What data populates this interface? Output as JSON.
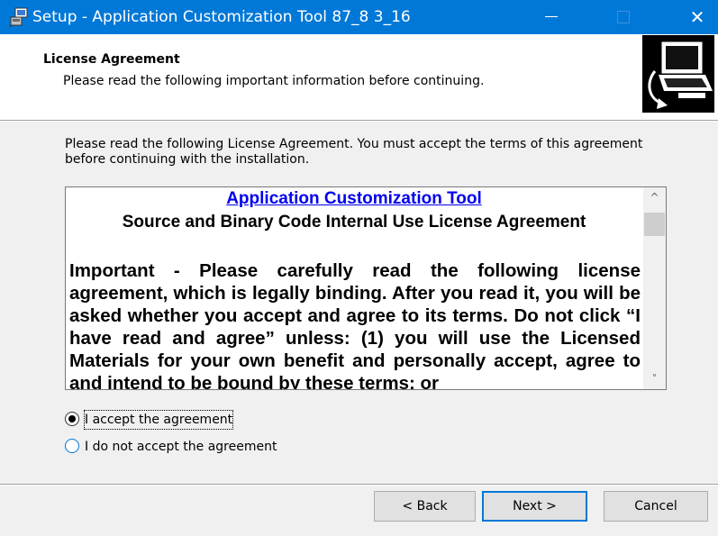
{
  "window": {
    "title": "Setup - Application Customization Tool 87_8 3_16",
    "close_glyph": "✕",
    "accent_color": "#0078d7"
  },
  "header": {
    "title": "License Agreement",
    "subtitle": "Please read the following important information before continuing.",
    "logo_icon": "computer-install-icon"
  },
  "intro": {
    "text": "Please read the following License Agreement. You must accept the terms of this agreement before continuing with the installation."
  },
  "license": {
    "heading": "Application Customization Tool",
    "subheading": "Source and Binary Code Internal Use License Agreement",
    "body": "Important - Please carefully read the following license agreement, which is legally binding.  After you read it, you will be asked whether you accept and agree to its terms.  Do not click  “I have read and agree” unless: (1) you will use the Licensed Materials for your own benefit and personally accept, agree to and intend to be bound by these terms; or",
    "scroll_up_glyph": "^",
    "scroll_down_glyph": "˅"
  },
  "options": {
    "accept": {
      "label": "I accept the agreement",
      "selected": true
    },
    "decline": {
      "label": "I do not accept the agreement",
      "selected": false
    }
  },
  "buttons": {
    "back": "< Back",
    "next": "Next >",
    "cancel": "Cancel"
  }
}
